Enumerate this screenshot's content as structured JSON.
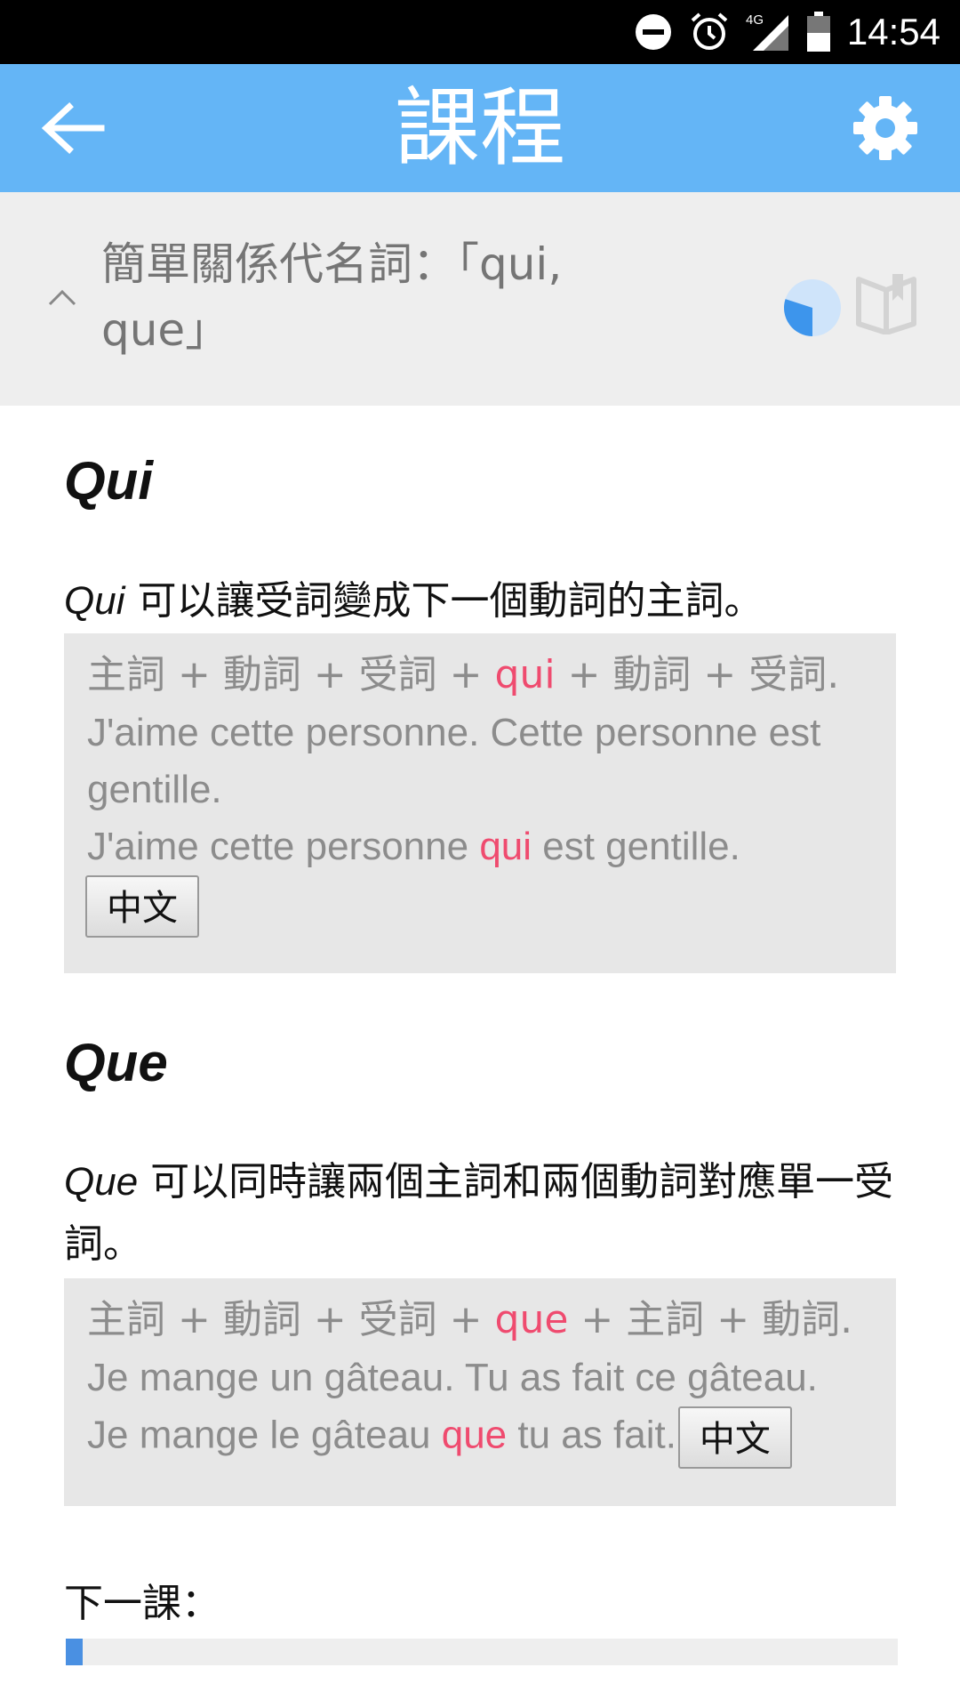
{
  "status_bar": {
    "time": "14:54",
    "network": "4G",
    "icons": [
      "do-not-disturb-icon",
      "alarm-icon",
      "signal-icon",
      "battery-icon"
    ]
  },
  "app_bar": {
    "title": "課程",
    "back_icon": "arrow-left-icon",
    "settings_icon": "gear-icon",
    "color": "#64b5f6"
  },
  "lesson": {
    "title": "簡單關係代名詞：「qui, que」",
    "collapse_icon": "chevron-up-icon",
    "progress_fraction": 0.3,
    "book_icon": "book-icon"
  },
  "sections": [
    {
      "heading": "Qui",
      "desc_term": "Qui",
      "desc_text": " 可以讓受詞變成下一個動詞的主詞。",
      "formula": [
        "主詞 + 動詞 + 受詞 + ",
        "qui",
        " + 動詞 + 受詞."
      ],
      "example1": "J'aime cette personne. Cette personne est gentille.",
      "example2": [
        "J'aime cette personne ",
        "qui",
        " est gentille."
      ],
      "translate_button": "中文"
    },
    {
      "heading": "Que",
      "desc_term": "Que",
      "desc_text": " 可以同時讓兩個主詞和兩個動詞對應單一受詞。",
      "formula": [
        "主詞 + 動詞 + 受詞 + ",
        "que",
        " + 主詞 + 動詞."
      ],
      "example1": "Je mange un gâteau. Tu as fait ce gâteau.",
      "example2": [
        "Je mange le gâteau ",
        "que",
        " tu as fait."
      ],
      "translate_button": "中文"
    }
  ],
  "next_lesson": {
    "label": "下一課：",
    "progress_fraction": 0.02
  },
  "colors": {
    "highlight": "#ef4b6f",
    "accent": "#4a90e2"
  }
}
